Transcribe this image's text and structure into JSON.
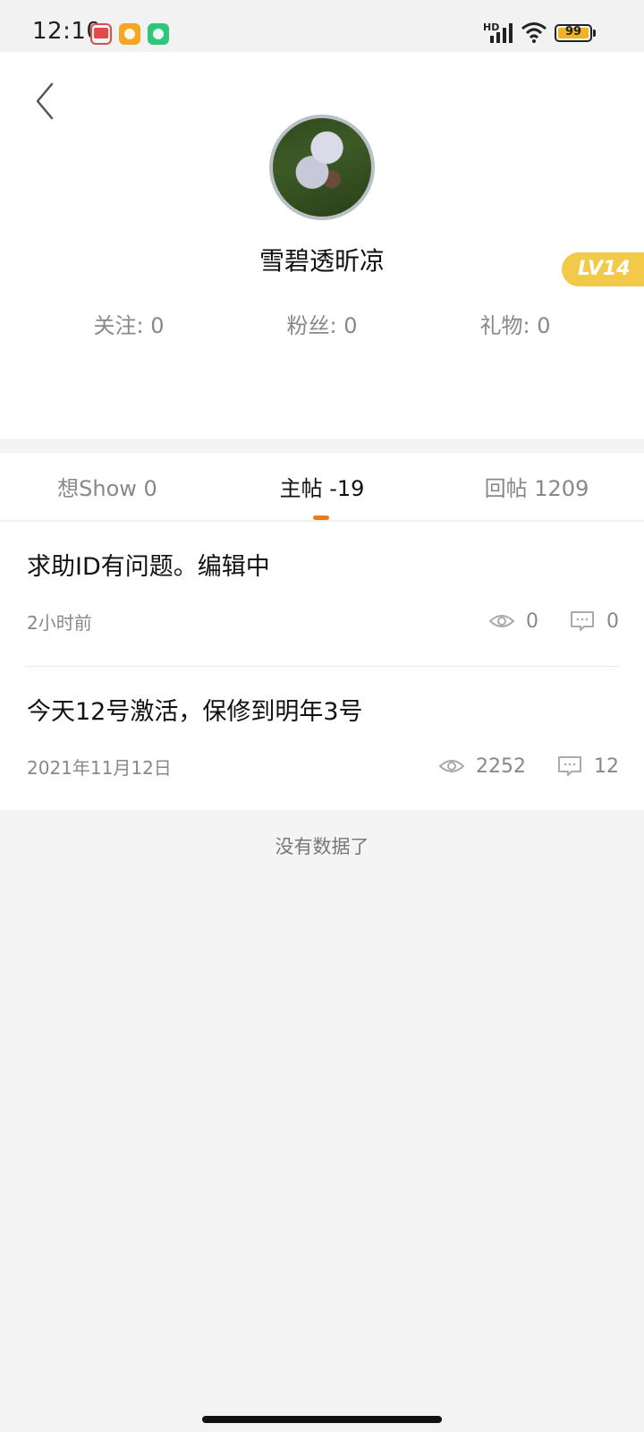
{
  "status_bar": {
    "time": "12:10",
    "hd_label": "HD",
    "battery": "99",
    "icons": [
      "unicom-app-icon",
      "cloud-app-icon",
      "shield-app-icon",
      "signal-icon",
      "wifi-icon",
      "battery-icon"
    ]
  },
  "profile": {
    "username": "雪碧透昕凉",
    "level": "LV14",
    "stats": {
      "follow": "关注: 0",
      "fans": "粉丝: 0",
      "gifts": "礼物: 0"
    }
  },
  "tabs": [
    {
      "label": "想Show 0",
      "active": false
    },
    {
      "label": "主帖 -19",
      "active": true
    },
    {
      "label": "回帖 1209",
      "active": false
    }
  ],
  "posts": [
    {
      "title": "求助ID有问题。编辑中",
      "time": "2小时前",
      "views": "0",
      "comments": "0"
    },
    {
      "title": "今天12号激活，保修到明年3号",
      "time": "2021年11月12日",
      "views": "2252",
      "comments": "12"
    }
  ],
  "footer": {
    "no_more": "没有数据了"
  },
  "colors": {
    "accent": "#f07a1a",
    "level_badge": "#f3c94a",
    "battery": "#f2b321"
  }
}
